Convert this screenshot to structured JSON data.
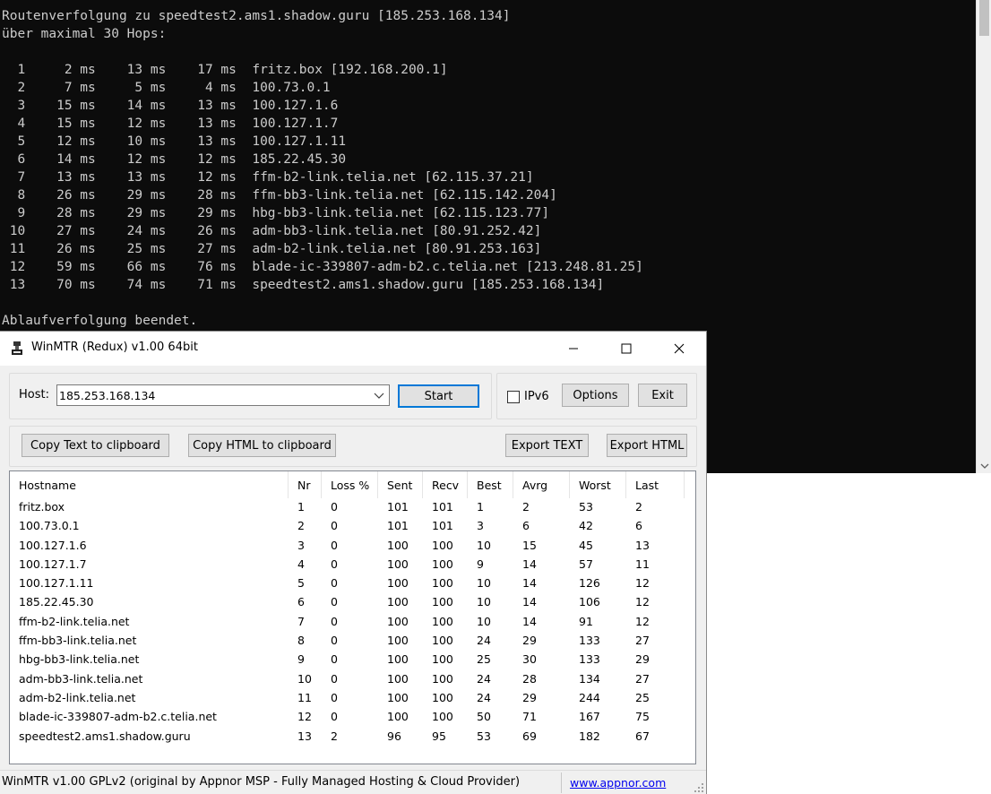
{
  "console": {
    "lines": [
      "Routenverfolgung zu speedtest2.ams1.shadow.guru [185.253.168.134]",
      "über maximal 30 Hops:",
      "",
      "  1     2 ms    13 ms    17 ms  fritz.box [192.168.200.1]",
      "  2     7 ms     5 ms     4 ms  100.73.0.1",
      "  3    15 ms    14 ms    13 ms  100.127.1.6",
      "  4    15 ms    12 ms    13 ms  100.127.1.7",
      "  5    12 ms    10 ms    13 ms  100.127.1.11",
      "  6    14 ms    12 ms    12 ms  185.22.45.30",
      "  7    13 ms    13 ms    12 ms  ffm-b2-link.telia.net [62.115.37.21]",
      "  8    26 ms    29 ms    28 ms  ffm-bb3-link.telia.net [62.115.142.204]",
      "  9    28 ms    29 ms    29 ms  hbg-bb3-link.telia.net [62.115.123.77]",
      " 10    27 ms    24 ms    26 ms  adm-bb3-link.telia.net [80.91.252.42]",
      " 11    26 ms    25 ms    27 ms  adm-b2-link.telia.net [80.91.253.163]",
      " 12    59 ms    66 ms    76 ms  blade-ic-339807-adm-b2.c.telia.net [213.248.81.25]",
      " 13    70 ms    74 ms    71 ms  speedtest2.ams1.shadow.guru [185.253.168.134]",
      "",
      "Ablaufverfolgung beendet."
    ],
    "scroll_down_icon": "chevron-down-icon"
  },
  "winmtr": {
    "title": "WinMTR (Redux) v1.00 64bit",
    "host_label": "Host:",
    "host_value": "185.253.168.134",
    "start_label": "Start",
    "ipv6_label": "IPv6",
    "ipv6_checked": false,
    "options_label": "Options",
    "exit_label": "Exit",
    "copy_text_label": "Copy Text to clipboard",
    "copy_html_label": "Copy HTML to clipboard",
    "export_text_label": "Export TEXT",
    "export_html_label": "Export HTML",
    "columns": [
      "Hostname",
      "Nr",
      "Loss %",
      "Sent",
      "Recv",
      "Best",
      "Avrg",
      "Worst",
      "Last"
    ],
    "rows": [
      [
        "fritz.box",
        "1",
        "0",
        "101",
        "101",
        "1",
        "2",
        "53",
        "2"
      ],
      [
        "100.73.0.1",
        "2",
        "0",
        "101",
        "101",
        "3",
        "6",
        "42",
        "6"
      ],
      [
        "100.127.1.6",
        "3",
        "0",
        "100",
        "100",
        "10",
        "15",
        "45",
        "13"
      ],
      [
        "100.127.1.7",
        "4",
        "0",
        "100",
        "100",
        "9",
        "14",
        "57",
        "11"
      ],
      [
        "100.127.1.11",
        "5",
        "0",
        "100",
        "100",
        "10",
        "14",
        "126",
        "12"
      ],
      [
        "185.22.45.30",
        "6",
        "0",
        "100",
        "100",
        "10",
        "14",
        "106",
        "12"
      ],
      [
        "ffm-b2-link.telia.net",
        "7",
        "0",
        "100",
        "100",
        "10",
        "14",
        "91",
        "12"
      ],
      [
        "ffm-bb3-link.telia.net",
        "8",
        "0",
        "100",
        "100",
        "24",
        "29",
        "133",
        "27"
      ],
      [
        "hbg-bb3-link.telia.net",
        "9",
        "0",
        "100",
        "100",
        "25",
        "30",
        "133",
        "29"
      ],
      [
        "adm-bb3-link.telia.net",
        "10",
        "0",
        "100",
        "100",
        "24",
        "28",
        "134",
        "27"
      ],
      [
        "adm-b2-link.telia.net",
        "11",
        "0",
        "100",
        "100",
        "24",
        "29",
        "244",
        "25"
      ],
      [
        "blade-ic-339807-adm-b2.c.telia.net",
        "12",
        "0",
        "100",
        "100",
        "50",
        "71",
        "167",
        "75"
      ],
      [
        "speedtest2.ams1.shadow.guru",
        "13",
        "2",
        "96",
        "95",
        "53",
        "69",
        "182",
        "67"
      ]
    ],
    "status_text": "WinMTR v1.00 GPLv2 (original by Appnor MSP - Fully Managed Hosting & Cloud Provider)",
    "status_link": "www.appnor.com"
  }
}
